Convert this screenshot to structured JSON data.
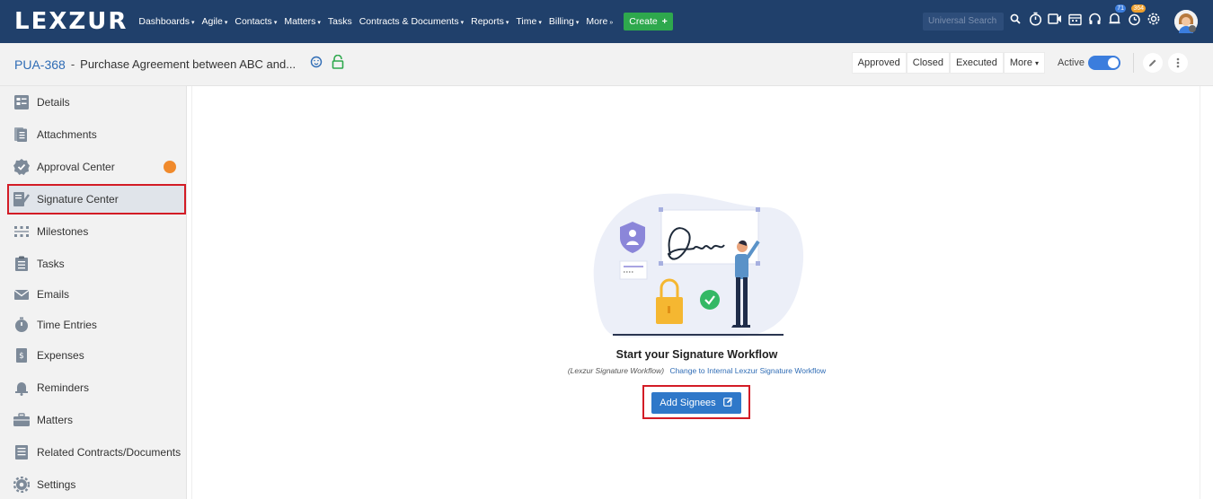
{
  "app": {
    "logo": "LEXZUR",
    "menu": [
      {
        "label": "Dashboards",
        "caret": "▾"
      },
      {
        "label": "Agile",
        "caret": "▾"
      },
      {
        "label": "Contacts",
        "caret": "▾"
      },
      {
        "label": "Matters",
        "caret": "▾"
      },
      {
        "label": "Tasks",
        "caret": ""
      },
      {
        "label": "Contracts & Documents",
        "caret": "▾"
      },
      {
        "label": "Reports",
        "caret": "▾"
      },
      {
        "label": "Time",
        "caret": "▾"
      },
      {
        "label": "Billing",
        "caret": "▾"
      },
      {
        "label": "More",
        "caret": "»"
      }
    ],
    "create_label": "Create",
    "create_plus": "+",
    "search_placeholder": "Universal Search",
    "badges": {
      "notifications": "71",
      "reminders": "364"
    },
    "colors": {
      "nav": "#20406b",
      "accent": "#2f78c9",
      "create": "#2ea84d",
      "highlight": "#d31c26"
    }
  },
  "header": {
    "id": "PUA-368",
    "separator": "-",
    "title": "Purchase Agreement between ABC and...",
    "status_buttons": [
      "Approved",
      "Closed",
      "Executed",
      "More"
    ],
    "more_caret": "▾",
    "active_label": "Active"
  },
  "sidebar": {
    "items": [
      {
        "label": "Details",
        "icon": "details-icon"
      },
      {
        "label": "Attachments",
        "icon": "attachments-icon"
      },
      {
        "label": "Approval Center",
        "icon": "approval-icon"
      },
      {
        "label": "Signature Center",
        "icon": "signature-icon"
      },
      {
        "label": "Milestones",
        "icon": "milestones-icon"
      },
      {
        "label": "Tasks",
        "icon": "tasks-icon"
      },
      {
        "label": "Emails",
        "icon": "email-icon"
      },
      {
        "label": "Time Entries",
        "icon": "stopwatch-icon"
      },
      {
        "label": "Expenses",
        "icon": "expenses-icon"
      },
      {
        "label": "Reminders",
        "icon": "bell-icon"
      },
      {
        "label": "Matters",
        "icon": "briefcase-icon"
      },
      {
        "label": "Related Contracts/Documents",
        "icon": "related-docs-icon"
      },
      {
        "label": "Settings",
        "icon": "settings-icon"
      }
    ]
  },
  "main": {
    "title": "Start your Signature Workflow",
    "mode": "(Lexzur Signature Workflow)",
    "switch_link": "Change to Internal Lexzur Signature Workflow",
    "add_button": "Add Signees"
  }
}
